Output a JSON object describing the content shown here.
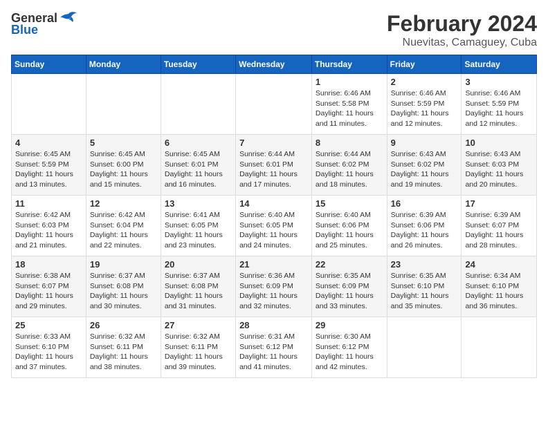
{
  "header": {
    "logo_general": "General",
    "logo_blue": "Blue",
    "title": "February 2024",
    "subtitle": "Nuevitas, Camaguey, Cuba"
  },
  "days_of_week": [
    "Sunday",
    "Monday",
    "Tuesday",
    "Wednesday",
    "Thursday",
    "Friday",
    "Saturday"
  ],
  "weeks": [
    [
      {
        "day": "",
        "info": ""
      },
      {
        "day": "",
        "info": ""
      },
      {
        "day": "",
        "info": ""
      },
      {
        "day": "",
        "info": ""
      },
      {
        "day": "1",
        "info": "Sunrise: 6:46 AM\nSunset: 5:58 PM\nDaylight: 11 hours and 11 minutes."
      },
      {
        "day": "2",
        "info": "Sunrise: 6:46 AM\nSunset: 5:59 PM\nDaylight: 11 hours and 12 minutes."
      },
      {
        "day": "3",
        "info": "Sunrise: 6:46 AM\nSunset: 5:59 PM\nDaylight: 11 hours and 12 minutes."
      }
    ],
    [
      {
        "day": "4",
        "info": "Sunrise: 6:45 AM\nSunset: 5:59 PM\nDaylight: 11 hours and 13 minutes."
      },
      {
        "day": "5",
        "info": "Sunrise: 6:45 AM\nSunset: 6:00 PM\nDaylight: 11 hours and 15 minutes."
      },
      {
        "day": "6",
        "info": "Sunrise: 6:45 AM\nSunset: 6:01 PM\nDaylight: 11 hours and 16 minutes."
      },
      {
        "day": "7",
        "info": "Sunrise: 6:44 AM\nSunset: 6:01 PM\nDaylight: 11 hours and 17 minutes."
      },
      {
        "day": "8",
        "info": "Sunrise: 6:44 AM\nSunset: 6:02 PM\nDaylight: 11 hours and 18 minutes."
      },
      {
        "day": "9",
        "info": "Sunrise: 6:43 AM\nSunset: 6:02 PM\nDaylight: 11 hours and 19 minutes."
      },
      {
        "day": "10",
        "info": "Sunrise: 6:43 AM\nSunset: 6:03 PM\nDaylight: 11 hours and 20 minutes."
      }
    ],
    [
      {
        "day": "11",
        "info": "Sunrise: 6:42 AM\nSunset: 6:03 PM\nDaylight: 11 hours and 21 minutes."
      },
      {
        "day": "12",
        "info": "Sunrise: 6:42 AM\nSunset: 6:04 PM\nDaylight: 11 hours and 22 minutes."
      },
      {
        "day": "13",
        "info": "Sunrise: 6:41 AM\nSunset: 6:05 PM\nDaylight: 11 hours and 23 minutes."
      },
      {
        "day": "14",
        "info": "Sunrise: 6:40 AM\nSunset: 6:05 PM\nDaylight: 11 hours and 24 minutes."
      },
      {
        "day": "15",
        "info": "Sunrise: 6:40 AM\nSunset: 6:06 PM\nDaylight: 11 hours and 25 minutes."
      },
      {
        "day": "16",
        "info": "Sunrise: 6:39 AM\nSunset: 6:06 PM\nDaylight: 11 hours and 26 minutes."
      },
      {
        "day": "17",
        "info": "Sunrise: 6:39 AM\nSunset: 6:07 PM\nDaylight: 11 hours and 28 minutes."
      }
    ],
    [
      {
        "day": "18",
        "info": "Sunrise: 6:38 AM\nSunset: 6:07 PM\nDaylight: 11 hours and 29 minutes."
      },
      {
        "day": "19",
        "info": "Sunrise: 6:37 AM\nSunset: 6:08 PM\nDaylight: 11 hours and 30 minutes."
      },
      {
        "day": "20",
        "info": "Sunrise: 6:37 AM\nSunset: 6:08 PM\nDaylight: 11 hours and 31 minutes."
      },
      {
        "day": "21",
        "info": "Sunrise: 6:36 AM\nSunset: 6:09 PM\nDaylight: 11 hours and 32 minutes."
      },
      {
        "day": "22",
        "info": "Sunrise: 6:35 AM\nSunset: 6:09 PM\nDaylight: 11 hours and 33 minutes."
      },
      {
        "day": "23",
        "info": "Sunrise: 6:35 AM\nSunset: 6:10 PM\nDaylight: 11 hours and 35 minutes."
      },
      {
        "day": "24",
        "info": "Sunrise: 6:34 AM\nSunset: 6:10 PM\nDaylight: 11 hours and 36 minutes."
      }
    ],
    [
      {
        "day": "25",
        "info": "Sunrise: 6:33 AM\nSunset: 6:10 PM\nDaylight: 11 hours and 37 minutes."
      },
      {
        "day": "26",
        "info": "Sunrise: 6:32 AM\nSunset: 6:11 PM\nDaylight: 11 hours and 38 minutes."
      },
      {
        "day": "27",
        "info": "Sunrise: 6:32 AM\nSunset: 6:11 PM\nDaylight: 11 hours and 39 minutes."
      },
      {
        "day": "28",
        "info": "Sunrise: 6:31 AM\nSunset: 6:12 PM\nDaylight: 11 hours and 41 minutes."
      },
      {
        "day": "29",
        "info": "Sunrise: 6:30 AM\nSunset: 6:12 PM\nDaylight: 11 hours and 42 minutes."
      },
      {
        "day": "",
        "info": ""
      },
      {
        "day": "",
        "info": ""
      }
    ]
  ]
}
